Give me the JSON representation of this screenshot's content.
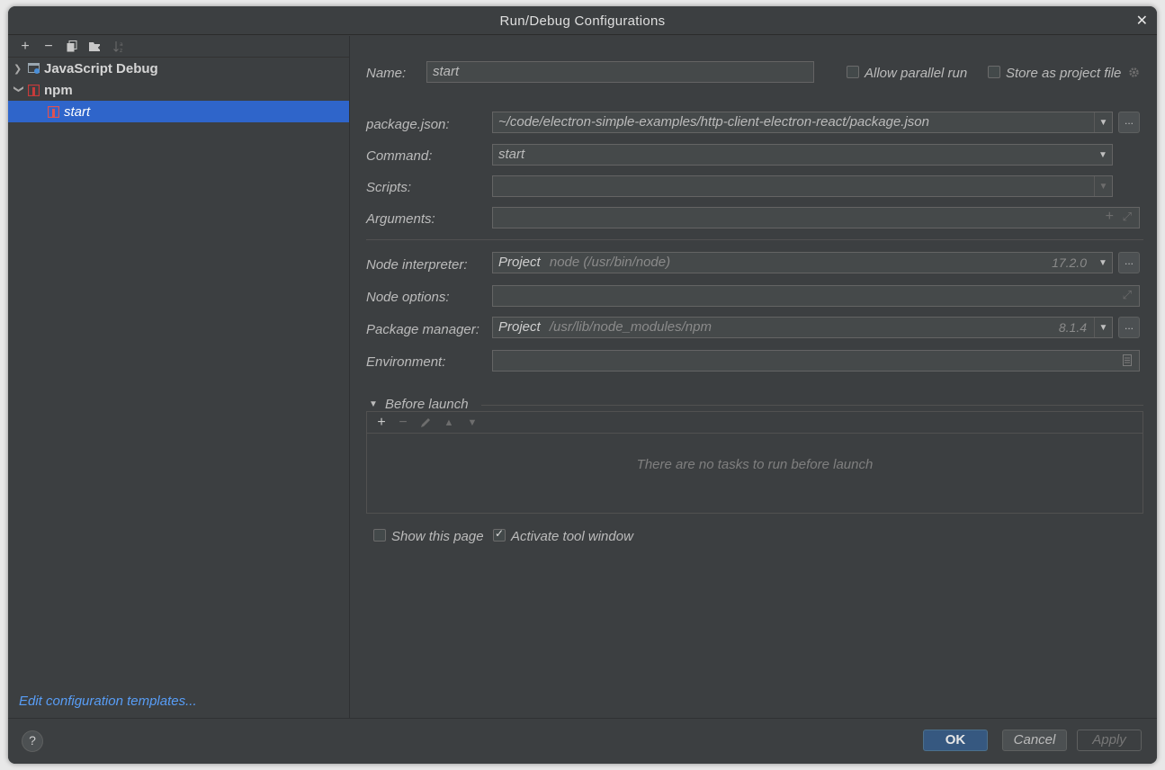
{
  "window": {
    "title": "Run/Debug Configurations"
  },
  "sidebar": {
    "tree": [
      {
        "label": "JavaScript Debug",
        "expanded": false
      },
      {
        "label": "npm",
        "expanded": true
      },
      {
        "label": "start",
        "selected": true
      }
    ],
    "edit_templates_link": "Edit configuration templates..."
  },
  "form": {
    "name_label": "Name:",
    "name_value": "start",
    "allow_parallel_label": "Allow parallel run",
    "allow_parallel_checked": false,
    "store_project_label": "Store as project file",
    "store_project_checked": false,
    "package_json_label": "package.json:",
    "package_json_value": "~/code/electron-simple-examples/http-client-electron-react/package.json",
    "command_label": "Command:",
    "command_value": "start",
    "scripts_label": "Scripts:",
    "scripts_value": "",
    "arguments_label": "Arguments:",
    "arguments_value": "",
    "node_interpreter_label": "Node interpreter:",
    "node_interpreter_main": "Project",
    "node_interpreter_hint": "node (/usr/bin/node)",
    "node_interpreter_version": "17.2.0",
    "node_options_label": "Node options:",
    "node_options_value": "",
    "package_manager_label": "Package manager:",
    "package_manager_main": "Project",
    "package_manager_hint": "/usr/lib/node_modules/npm",
    "package_manager_version": "8.1.4",
    "environment_label": "Environment:",
    "environment_value": "",
    "browse_button": "..."
  },
  "before_launch": {
    "title": "Before launch",
    "empty_text": "There are no tasks to run before launch"
  },
  "options": {
    "show_page_label": "Show this page",
    "show_page_checked": false,
    "activate_tool_label": "Activate tool window",
    "activate_tool_checked": true
  },
  "footer": {
    "help": "?",
    "ok": "OK",
    "cancel": "Cancel",
    "apply": "Apply"
  },
  "colors": {
    "background": "#3c3f41",
    "selection": "#2f65ca",
    "link": "#589df6",
    "ok_button": "#365880"
  }
}
